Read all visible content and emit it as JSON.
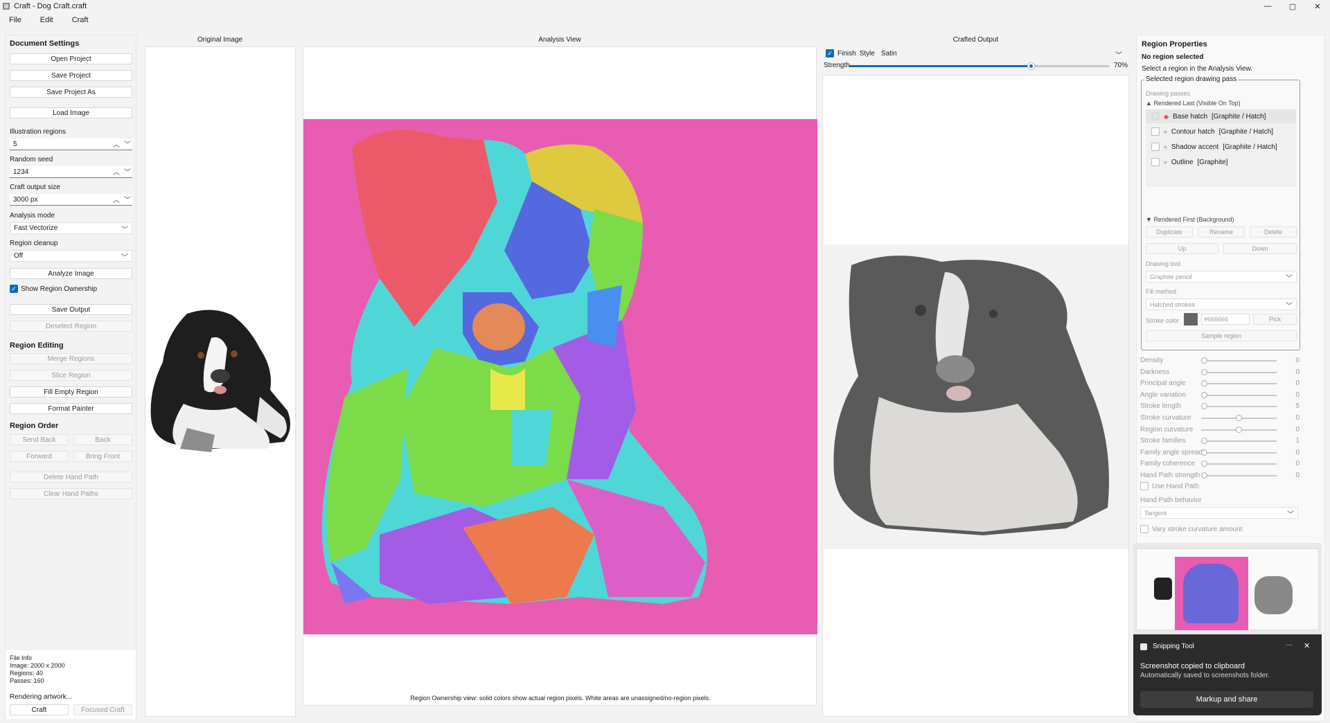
{
  "window": {
    "title": "Craft - Dog Craft.craft"
  },
  "menu": [
    "File",
    "Edit",
    "Craft"
  ],
  "left": {
    "doc_settings_title": "Document Settings",
    "open_project": "Open Project",
    "save_project": "Save Project",
    "save_project_as": "Save Project As",
    "load_image": "Load Image",
    "illustration_regions_label": "Illustration regions",
    "illustration_regions_value": "5",
    "random_seed_label": "Random seed",
    "random_seed_value": "1234",
    "output_size_label": "Craft output size",
    "output_size_value": "3000 px",
    "analysis_mode_label": "Analysis mode",
    "analysis_mode_value": "Fast Vectorize",
    "region_cleanup_label": "Region cleanup",
    "region_cleanup_value": "Off",
    "analyze_image": "Analyze Image",
    "show_region_ownership": "Show Region Ownership",
    "save_output": "Save Output",
    "deselect_region": "Deselect Region",
    "region_editing_title": "Region Editing",
    "merge_regions": "Merge Regions",
    "slice_region": "Slice Region",
    "fill_empty_region": "Fill Empty Region",
    "format_painter": "Format Painter",
    "region_order_title": "Region Order",
    "send_back": "Send Back",
    "back": "Back",
    "forward": "Forward",
    "bring_front": "Bring Front",
    "delete_hand_path": "Delete Hand Path",
    "clear_hand_paths": "Clear Hand Paths",
    "file_info_title": "File Info",
    "file_image": "Image: 2000 x 2000",
    "file_regions": "Regions: 40",
    "file_passes": "Passes: 160",
    "rendering_status": "Rendering artwork...",
    "craft": "Craft",
    "focused_craft": "Focused Craft"
  },
  "columns": {
    "original": "Original Image",
    "analysis": "Analysis View",
    "crafted": "Crafted Output"
  },
  "crafted": {
    "finish_label": "Finish",
    "style_label": "Style",
    "style_value": "Satin",
    "strength_label": "Strength",
    "strength_value": "70%",
    "strength_fraction": 0.7
  },
  "analysis_caption": "Region Ownership view: solid colors show actual region pixels. White areas are unassigned/no-region pixels.",
  "right": {
    "title": "Region Properties",
    "no_region": "No region selected",
    "hint": "Select a region in the Analysis View.",
    "group_title": "Selected region drawing pass",
    "drawing_passes": "Drawing passes",
    "rendered_last": "Rendered Last (Visible On Top)",
    "passes": [
      {
        "name": "Base hatch",
        "tag": "[Graphite / Hatch]",
        "checked": true
      },
      {
        "name": "Contour hatch",
        "tag": "[Graphite / Hatch]",
        "checked": false
      },
      {
        "name": "Shadow accent",
        "tag": "[Graphite / Hatch]",
        "checked": false
      },
      {
        "name": "Outline",
        "tag": "[Graphite]",
        "checked": false
      }
    ],
    "rendered_first": "Rendered First (Background)",
    "duplicate": "Duplicate",
    "rename": "Rename",
    "delete": "Delete",
    "up": "Up",
    "down": "Down",
    "drawing_tool_label": "Drawing tool",
    "drawing_tool_value": "Graphite pencil",
    "fill_method_label": "Fill method",
    "fill_method_value": "Hatched strokes",
    "stroke_color_label": "Stroke color",
    "stroke_color_value": "#666666",
    "stroke_color_swatch": "#666666",
    "pick": "Pick",
    "sample_region": "Sample region",
    "sliders": [
      {
        "label": "Density",
        "value": "0",
        "pos": 0
      },
      {
        "label": "Darkness",
        "value": "0",
        "pos": 0
      },
      {
        "label": "Principal angle",
        "value": "0",
        "pos": 0
      },
      {
        "label": "Angle variation",
        "value": "0",
        "pos": 0
      },
      {
        "label": "Stroke length",
        "value": "5",
        "pos": 0
      },
      {
        "label": "Stroke curvature",
        "value": "0",
        "pos": 0.5
      },
      {
        "label": "Region curvature",
        "value": "0",
        "pos": 0.5
      },
      {
        "label": "Stroke families",
        "value": "1",
        "pos": 0
      },
      {
        "label": "Family angle spread",
        "value": "0",
        "pos": 0
      },
      {
        "label": "Family coherence",
        "value": "0",
        "pos": 0
      },
      {
        "label": "Hand Path strength",
        "value": "0",
        "pos": 0
      }
    ],
    "use_hand_path": "Use Hand Path",
    "hand_path_behavior_label": "Hand Path behavior",
    "hand_path_behavior_value": "Tangent",
    "vary_curvature": "Vary stroke curvature amount"
  },
  "toast": {
    "app": "Snipping Tool",
    "title": "Screenshot copied to clipboard",
    "body": "Automatically saved to screenshots folder.",
    "action": "Markup and share",
    "more": "···",
    "close": "✕"
  }
}
